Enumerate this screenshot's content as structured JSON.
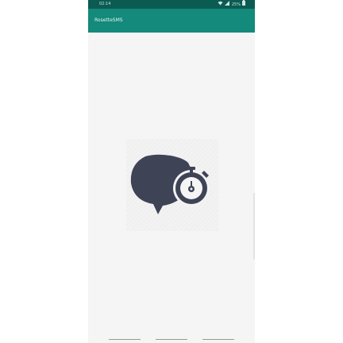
{
  "status_bar": {
    "time": "02:14",
    "battery": "25%",
    "icons": [
      "wifi-icon",
      "signal-icon",
      "battery-icon"
    ]
  },
  "app_bar": {
    "title": "RosetteSMS",
    "color": "#138a7b",
    "dark_color": "#0b5b52"
  },
  "logo": {
    "icon": "chat-bubble-stopwatch-icon",
    "color": "#3f4356"
  },
  "nav_bar": {
    "buttons": [
      "back-button",
      "home-button",
      "recents-button"
    ]
  }
}
